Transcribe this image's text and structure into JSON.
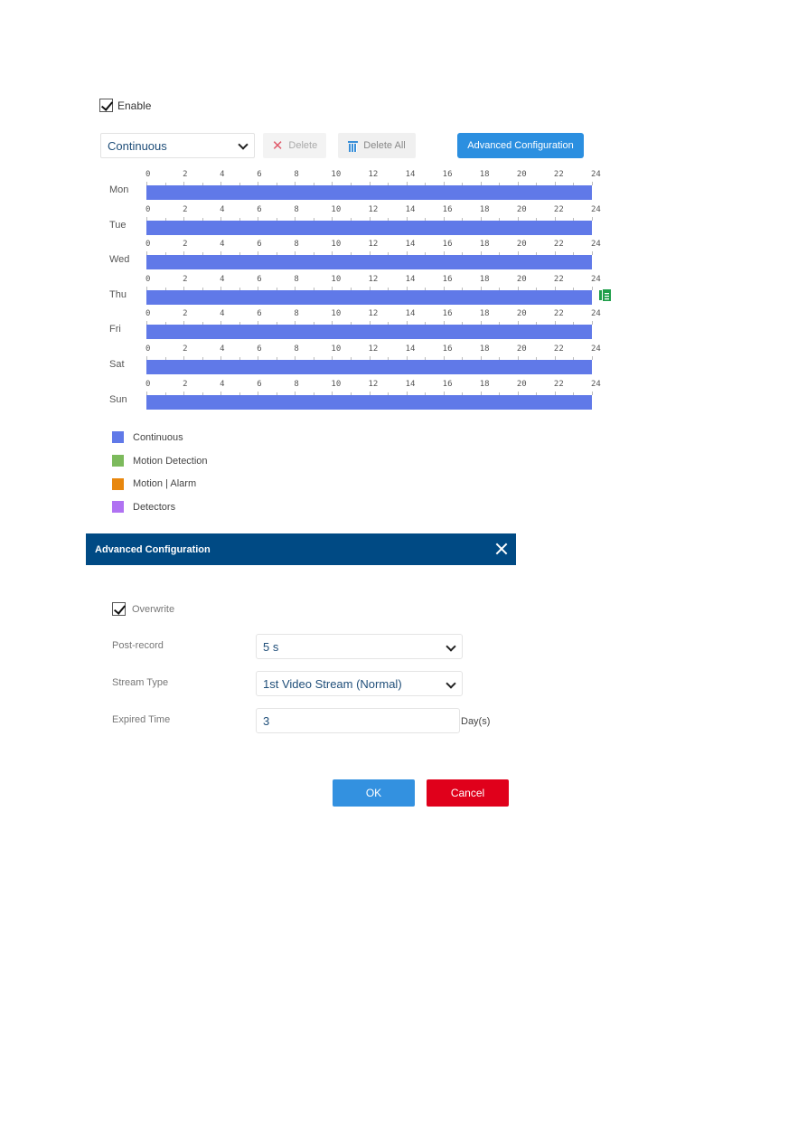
{
  "schedule_panel": {
    "enable": {
      "label": "Enable",
      "checked": true
    },
    "type_select": {
      "value": "Continuous"
    },
    "toolbar": {
      "delete_label": "Delete",
      "delete_all_label": "Delete All",
      "advanced_label": "Advanced Configuration"
    },
    "tick_labels": [
      "0",
      "2",
      "4",
      "6",
      "8",
      "10",
      "12",
      "14",
      "16",
      "18",
      "20",
      "22",
      "24"
    ],
    "hours_total": 24,
    "days": [
      {
        "label": "Mon",
        "segments": [
          {
            "type": "Continuous",
            "start": 0,
            "end": 24
          }
        ]
      },
      {
        "label": "Tue",
        "segments": [
          {
            "type": "Continuous",
            "start": 0,
            "end": 24
          }
        ]
      },
      {
        "label": "Wed",
        "segments": [
          {
            "type": "Continuous",
            "start": 0,
            "end": 24
          }
        ]
      },
      {
        "label": "Thu",
        "segments": [
          {
            "type": "Continuous",
            "start": 0,
            "end": 24
          }
        ],
        "copy_icon": "copy-to-icon"
      },
      {
        "label": "Fri",
        "segments": [
          {
            "type": "Continuous",
            "start": 0,
            "end": 24
          }
        ]
      },
      {
        "label": "Sat",
        "segments": [
          {
            "type": "Continuous",
            "start": 0,
            "end": 24
          }
        ]
      },
      {
        "label": "Sun",
        "segments": [
          {
            "type": "Continuous",
            "start": 0,
            "end": 24
          }
        ]
      }
    ],
    "legend": [
      {
        "label": "Continuous",
        "color": "#6079e8"
      },
      {
        "label": "Motion Detection",
        "color": "#7cba5c"
      },
      {
        "label": "Motion | Alarm",
        "color": "#e8870e"
      },
      {
        "label": "Detectors",
        "color": "#b072f2"
      }
    ]
  },
  "dialog": {
    "title": "Advanced Configuration",
    "overwrite": {
      "label": "Overwrite",
      "checked": true
    },
    "post_record": {
      "label": "Post-record",
      "value": "5 s"
    },
    "stream_type": {
      "label": "Stream Type",
      "value": "1st Video Stream (Normal)"
    },
    "expired_time": {
      "label": "Expired Time",
      "value": "3",
      "unit": "Day(s)"
    },
    "ok_label": "OK",
    "cancel_label": "Cancel"
  },
  "colors": {
    "header_bg": "#004a84",
    "primary": "#2b8fe0",
    "danger": "#e0001b"
  }
}
